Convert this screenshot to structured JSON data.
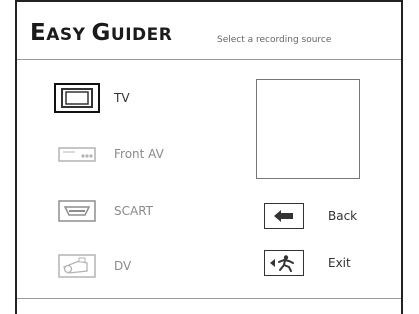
{
  "header": {
    "brand_first_initial": "E",
    "brand_first_rest": "ASY",
    "brand_second_initial": "G",
    "brand_second_rest": "UIDER",
    "subtitle": "Select a recording source"
  },
  "sources": [
    {
      "label": "TV",
      "icon": "tv-icon",
      "selected": true
    },
    {
      "label": "Front AV",
      "icon": "front-av-icon",
      "selected": false
    },
    {
      "label": "SCART",
      "icon": "scart-icon",
      "selected": false
    },
    {
      "label": "DV",
      "icon": "camcorder-icon",
      "selected": false
    }
  ],
  "actions": {
    "back_label": "Back",
    "exit_label": "Exit"
  },
  "colors": {
    "text": "#333333",
    "dim_text": "#8a8a8a",
    "frame": "#222222",
    "background": "#ffffff"
  }
}
